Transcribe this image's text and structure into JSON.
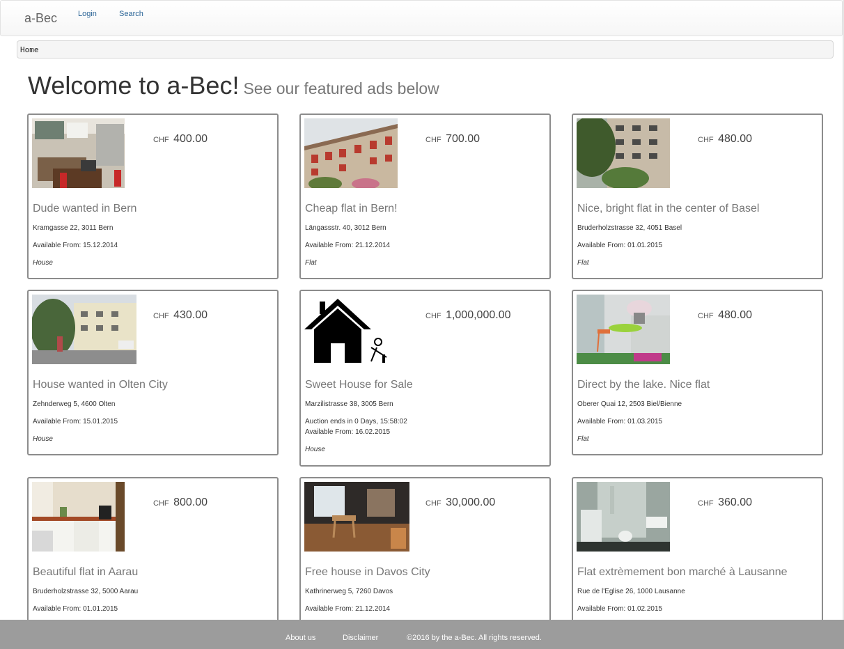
{
  "navbar": {
    "brand": "a-Bec",
    "login_label": "Login",
    "search_label": "Search"
  },
  "breadcrumb": {
    "home": "Home"
  },
  "header": {
    "title": "Welcome to a-Bec!",
    "subtitle": "See our featured ads below"
  },
  "ads": [
    {
      "currency": "CHF",
      "price": "400.00",
      "title": "Dude wanted in Bern",
      "address": "Kramgasse 22, 3011 Bern",
      "available": "Available From: 15.12.2014",
      "type": "House"
    },
    {
      "currency": "CHF",
      "price": "700.00",
      "title": "Cheap flat in Bern!",
      "address": "Längassstr. 40, 3012 Bern",
      "available": "Available From: 21.12.2014",
      "type": "Flat"
    },
    {
      "currency": "CHF",
      "price": "480.00",
      "title": "Nice, bright flat in the center of Basel",
      "address": "Bruderholzstrasse 32, 4051 Basel",
      "available": "Available From: 01.01.2015",
      "type": "Flat"
    },
    {
      "currency": "CHF",
      "price": "430.00",
      "title": "House wanted in Olten City",
      "address": "Zehnderweg 5, 4600 Olten",
      "available": "Available From: 15.01.2015",
      "type": "House"
    },
    {
      "currency": "CHF",
      "price": "1,000,000.00",
      "title": "Sweet House for Sale",
      "address": "Marzilistrasse 38, 3005 Bern",
      "auction": "Auction ends in 0 Days, 15:58:02",
      "available": "Available From: 16.02.2015",
      "type": "House"
    },
    {
      "currency": "CHF",
      "price": "480.00",
      "title": "Direct by the lake. Nice flat",
      "address": "Oberer Quai 12, 2503 Biel/Bienne",
      "available": "Available From: 01.03.2015",
      "type": "Flat"
    },
    {
      "currency": "CHF",
      "price": "800.00",
      "title": "Beautiful flat in Aarau",
      "address": "Bruderholzstrasse 32, 5000 Aarau",
      "available": "Available From: 01.01.2015"
    },
    {
      "currency": "CHF",
      "price": "30,000.00",
      "title": "Free house in Davos City",
      "address": "Kathrinerweg 5, 7260 Davos",
      "available": "Available From: 21.12.2014"
    },
    {
      "currency": "CHF",
      "price": "360.00",
      "title": "Flat extrèmement bon marché à Lausanne",
      "address": "Rue de l'Eglise 26, 1000 Lausanne",
      "available": "Available From: 01.02.2015"
    }
  ],
  "footer": {
    "about_label": "About us",
    "disclaimer_label": "Disclaimer",
    "copyright": "©2016 by the a-Bec. All rights reserved."
  }
}
